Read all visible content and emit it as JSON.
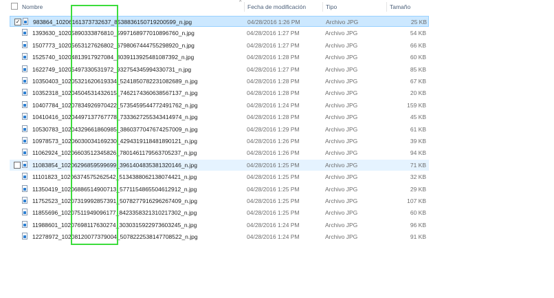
{
  "columns": {
    "name": "Nombre",
    "date": "Fecha de modificación",
    "type": "Tipo",
    "size": "Tamaño"
  },
  "sort_glyph": "^",
  "files": [
    {
      "name": "983864_10206161373732637_8538836150719200599_n.jpg",
      "date": "04/28/2016 1:26 PM",
      "type": "Archivo JPG",
      "size": "25 KB",
      "state": "selected"
    },
    {
      "name": "1393630_10205890333876810_5997168977010896760_n.jpg",
      "date": "04/28/2016 1:27 PM",
      "type": "Archivo JPG",
      "size": "54 KB",
      "state": ""
    },
    {
      "name": "1507773_10205653127626802_6798067444755298920_n.jpg",
      "date": "04/28/2016 1:27 PM",
      "type": "Archivo JPG",
      "size": "66 KB",
      "state": ""
    },
    {
      "name": "1525740_10204813917927084_8039113925481087392_n.jpg",
      "date": "04/28/2016 1:28 PM",
      "type": "Archivo JPG",
      "size": "60 KB",
      "state": ""
    },
    {
      "name": "1622749_10205497330531972_932754345994330731_n.jpg",
      "date": "04/28/2016 1:27 PM",
      "type": "Archivo JPG",
      "size": "85 KB",
      "state": ""
    },
    {
      "name": "10350403_10205321620619334_5241850782231082689_n.jpg",
      "date": "04/28/2016 1:28 PM",
      "type": "Archivo JPG",
      "size": "67 KB",
      "state": ""
    },
    {
      "name": "10352318_10204504531432615_7462174360638567137_n.jpg",
      "date": "04/28/2016 1:28 PM",
      "type": "Archivo JPG",
      "size": "20 KB",
      "state": ""
    },
    {
      "name": "10407784_10207834926970422_5735459544772491762_n.jpg",
      "date": "04/28/2016 1:24 PM",
      "type": "Archivo JPG",
      "size": "159 KB",
      "state": ""
    },
    {
      "name": "10410416_10204497137767778_7333627255343414974_n.jpg",
      "date": "04/28/2016 1:28 PM",
      "type": "Archivo JPG",
      "size": "45 KB",
      "state": ""
    },
    {
      "name": "10530783_10204329661860985_3860377047674257009_n.jpg",
      "date": "04/28/2016 1:29 PM",
      "type": "Archivo JPG",
      "size": "61 KB",
      "state": ""
    },
    {
      "name": "10978573_10206030034169230_4294319118481890121_n.jpg",
      "date": "04/28/2016 1:26 PM",
      "type": "Archivo JPG",
      "size": "39 KB",
      "state": ""
    },
    {
      "name": "11062924_10206603512345826_7801461179563705237_n.jpg",
      "date": "04/28/2016 1:26 PM",
      "type": "Archivo JPG",
      "size": "94 KB",
      "state": ""
    },
    {
      "name": "11083854_10206296859599699_3961404835381320146_n.jpg",
      "date": "04/28/2016 1:25 PM",
      "type": "Archivo JPG",
      "size": "71 KB",
      "state": "hover"
    },
    {
      "name": "11101823_10206374575262542_5134388062138074421_n.jpg",
      "date": "04/28/2016 1:25 PM",
      "type": "Archivo JPG",
      "size": "32 KB",
      "state": ""
    },
    {
      "name": "11350419_10206886514900713_5771154865504612912_n.jpg",
      "date": "04/28/2016 1:25 PM",
      "type": "Archivo JPG",
      "size": "29 KB",
      "state": ""
    },
    {
      "name": "11752523_10207319992857391_5078277916296267409_n.jpg",
      "date": "04/28/2016 1:25 PM",
      "type": "Archivo JPG",
      "size": "107 KB",
      "state": ""
    },
    {
      "name": "11855696_10207511949096177_8423358321310217302_n.jpg",
      "date": "04/28/2016 1:25 PM",
      "type": "Archivo JPG",
      "size": "60 KB",
      "state": ""
    },
    {
      "name": "11988601_10207698117630274_3030315922973603245_n.jpg",
      "date": "04/28/2016 1:24 PM",
      "type": "Archivo JPG",
      "size": "96 KB",
      "state": ""
    },
    {
      "name": "12278972_10208120077379004_5078222538147708522_n.jpg",
      "date": "04/28/2016 1:24 PM",
      "type": "Archivo JPG",
      "size": "91 KB",
      "state": ""
    }
  ]
}
